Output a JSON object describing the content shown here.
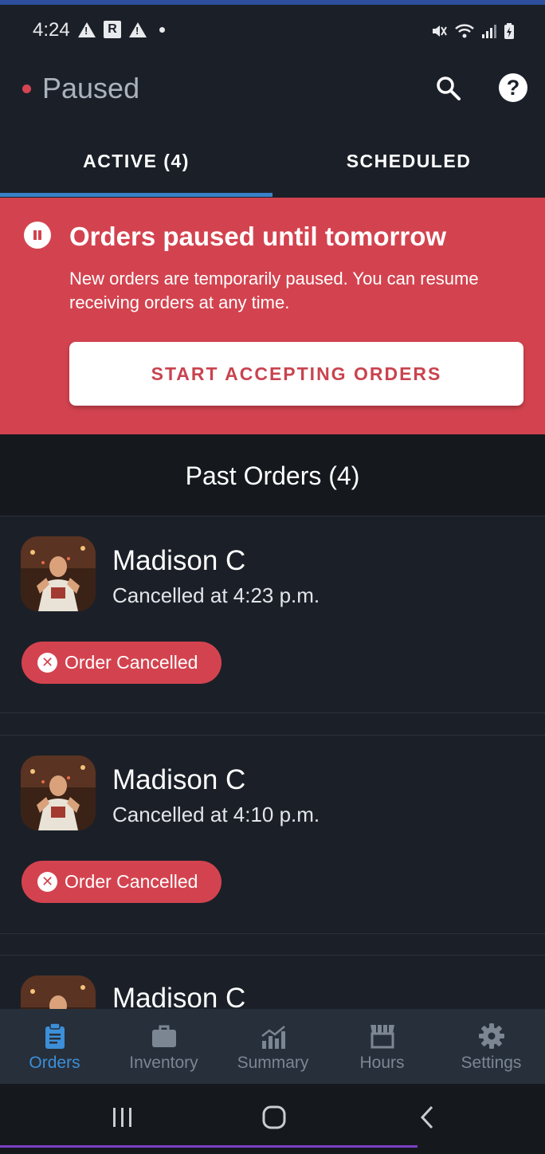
{
  "status_bar": {
    "time": "4:24",
    "left_icons": [
      "warning-icon",
      "r-app-icon",
      "warning-icon",
      "dot-icon"
    ],
    "right_icons": [
      "mute-icon",
      "wifi-icon",
      "signal-icon",
      "battery-icon"
    ]
  },
  "header": {
    "status_label": "Paused",
    "status_color": "#d54453",
    "search_icon": "search-icon",
    "help_icon": "help-icon"
  },
  "tabs": [
    {
      "label": "ACTIVE (4)",
      "selected": true
    },
    {
      "label": "SCHEDULED",
      "selected": false
    }
  ],
  "banner": {
    "title": "Orders paused until tomorrow",
    "message": "New orders are temporarily paused. You can resume receiving orders at any time.",
    "button_label": "START ACCEPTING ORDERS",
    "color": "#d3434f"
  },
  "past_orders": {
    "title": "Past Orders (4)",
    "orders": [
      {
        "customer": "Madison C",
        "status_time": "Cancelled at 4:23 p.m.",
        "badge": "Order Cancelled"
      },
      {
        "customer": "Madison C",
        "status_time": "Cancelled at 4:10 p.m.",
        "badge": "Order Cancelled"
      },
      {
        "customer": "Madison C",
        "status_time": "",
        "badge": ""
      }
    ]
  },
  "bottom_nav": {
    "active_color": "#3c8fd8",
    "items": [
      {
        "label": "Orders",
        "icon": "clipboard-icon",
        "active": true
      },
      {
        "label": "Inventory",
        "icon": "briefcase-icon",
        "active": false
      },
      {
        "label": "Summary",
        "icon": "chart-icon",
        "active": false
      },
      {
        "label": "Hours",
        "icon": "storefront-icon",
        "active": false
      },
      {
        "label": "Settings",
        "icon": "gear-icon",
        "active": false
      }
    ]
  },
  "system_nav": [
    "recents-icon",
    "home-icon",
    "back-icon"
  ]
}
